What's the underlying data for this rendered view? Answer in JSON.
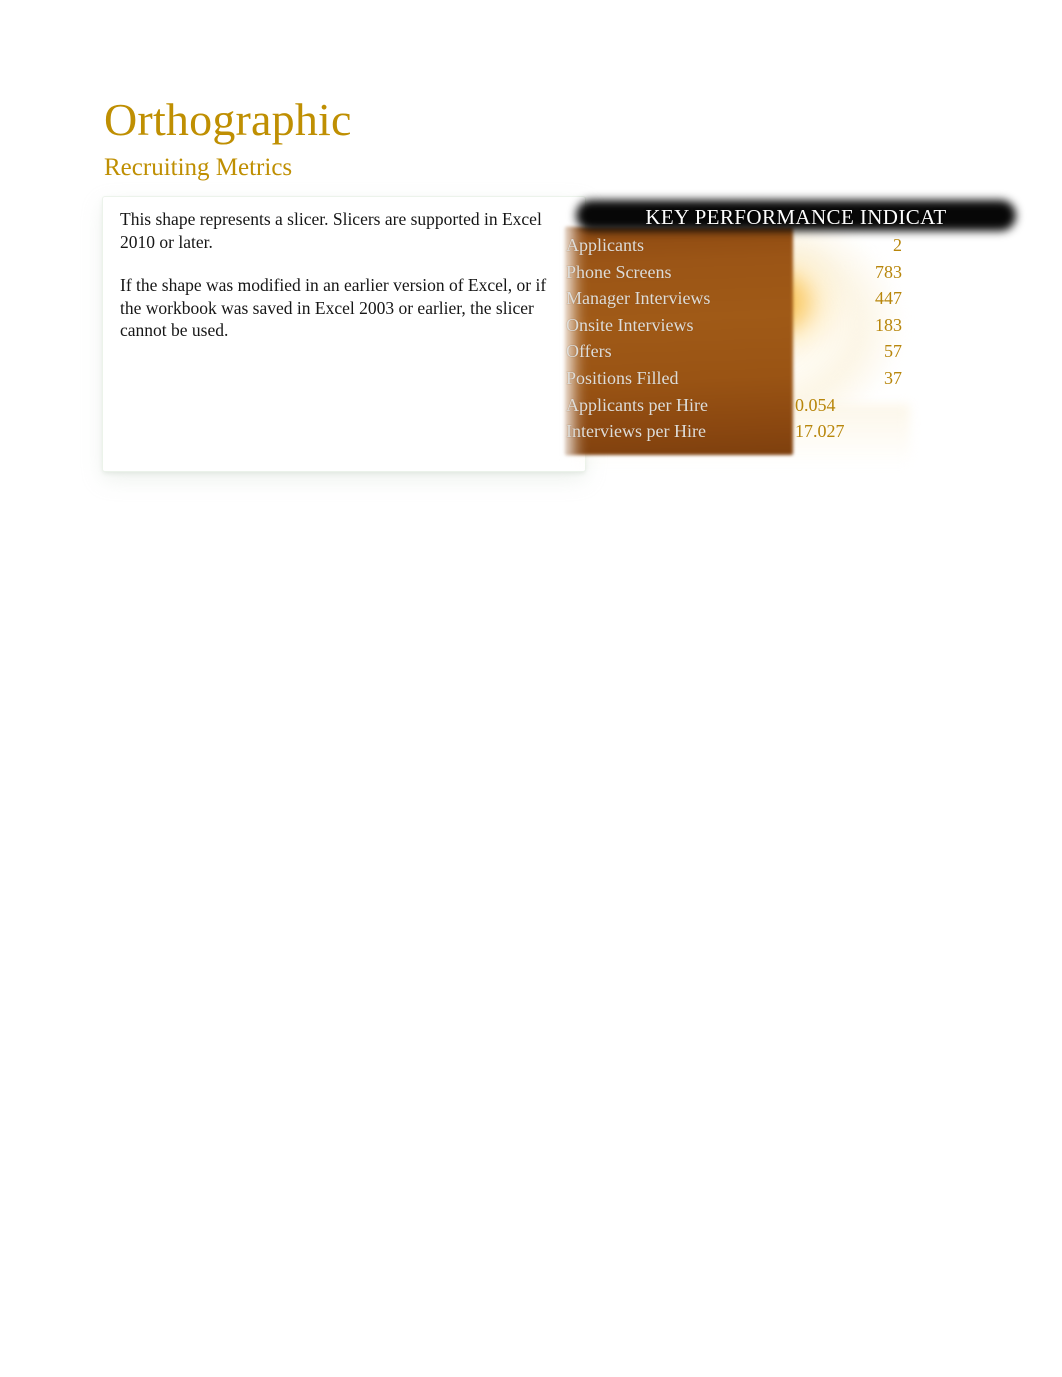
{
  "document": {
    "title": "Orthographic",
    "subtitle": "Recruiting Metrics"
  },
  "slicer_note": {
    "paragraph_1": "This shape represents a slicer. Slicers are supported in Excel 2010 or later.",
    "paragraph_2": "If the shape was modified in an earlier version of Excel, or if the workbook was saved in Excel 2003 or earlier, the slicer cannot be used."
  },
  "kpi_panel": {
    "header": "KEY PERFORMANCE INDICAT",
    "rows": [
      {
        "label": "Applicants",
        "value": "2",
        "column": "wide"
      },
      {
        "label": "Phone Screens",
        "value": "783",
        "column": "wide"
      },
      {
        "label": "Manager Interviews",
        "value": "447",
        "column": "wide"
      },
      {
        "label": "Onsite Interviews",
        "value": "183",
        "column": "wide"
      },
      {
        "label": "Offers",
        "value": "57",
        "column": "wide"
      },
      {
        "label": "Positions Filled",
        "value": "37",
        "column": "wide"
      },
      {
        "label": "Applicants per Hire",
        "value": "0.054",
        "column": "narrow"
      },
      {
        "label": "Interviews per Hire",
        "value": "17.027",
        "column": "narrow"
      }
    ]
  },
  "colors": {
    "title_gold": "#bf8f02",
    "value_gold": "#b8860b",
    "slicer_brown": "#9a5414",
    "header_bar": "#070707",
    "label_gray": "#dedcd8",
    "page_background": "#ffffff"
  }
}
